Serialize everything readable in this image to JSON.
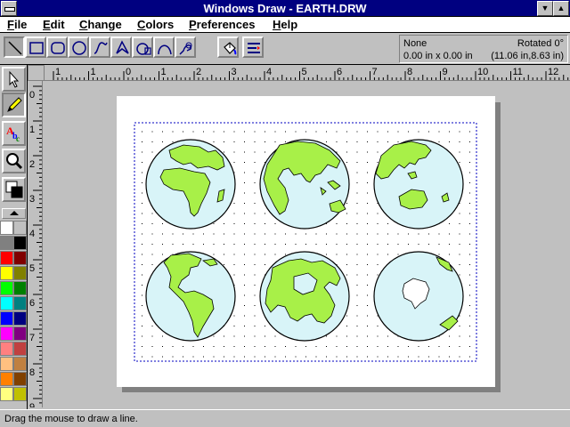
{
  "window": {
    "title": "Windows Draw - EARTH.DRW"
  },
  "title_controls": {
    "minimize": "▼",
    "maximize": "▲"
  },
  "menu": [
    {
      "label": "File",
      "u": "F",
      "rest": "ile"
    },
    {
      "label": "Edit",
      "u": "E",
      "rest": "dit"
    },
    {
      "label": "Change",
      "u": "C",
      "rest": "hange"
    },
    {
      "label": "Colors",
      "u": "C",
      "rest": "olors"
    },
    {
      "label": "Preferences",
      "u": "P",
      "rest": "references"
    },
    {
      "label": "Help",
      "u": "H",
      "rest": "elp"
    }
  ],
  "toolbar": {
    "tools": [
      "line-tool",
      "rectangle-tool",
      "rounded-rectangle-tool",
      "ellipse-tool",
      "curve-tool",
      "polygon-tool",
      "arc-tool",
      "freehand-tool",
      "bezier-tool"
    ],
    "actions": [
      "fill-bucket-tool",
      "text-flow-tool"
    ]
  },
  "info": {
    "fill": "None",
    "rotation": "Rotated 0°",
    "size": "0.00 in x 0.00 in",
    "position": "(11.06 in,8.63 in)"
  },
  "ruler": {
    "h_labels": [
      "1",
      "1",
      "0",
      "1",
      "2",
      "3",
      "4",
      "5",
      "6",
      "7",
      "8",
      "9",
      "10",
      "11",
      "12",
      "13"
    ],
    "v_labels": [
      "0",
      "1",
      "2",
      "3",
      "4",
      "5",
      "6",
      "7",
      "8",
      "9"
    ]
  },
  "palette": {
    "colors": [
      "#ffffff",
      "#c0c0c0",
      "#808080",
      "#000000",
      "#ff0000",
      "#800000",
      "#ffff00",
      "#808000",
      "#00ff00",
      "#008000",
      "#00ffff",
      "#008080",
      "#0000ff",
      "#000080",
      "#ff00ff",
      "#800080",
      "#ff8080",
      "#c04040",
      "#ffc080",
      "#c08040",
      "#ff8000",
      "#804000",
      "#ffff80",
      "#c0c000"
    ]
  },
  "colors": {
    "ocean": "#d8f4f8",
    "land": "#a8f048",
    "title_bar": "#000080",
    "dotted_frame": "#0000c0"
  },
  "globes": [
    "europe-africa-globe",
    "indian-ocean-globe",
    "asia-australia-globe",
    "americas-globe",
    "arctic-globe",
    "antarctica-globe"
  ],
  "status": {
    "text": "Drag the mouse to draw a line."
  }
}
